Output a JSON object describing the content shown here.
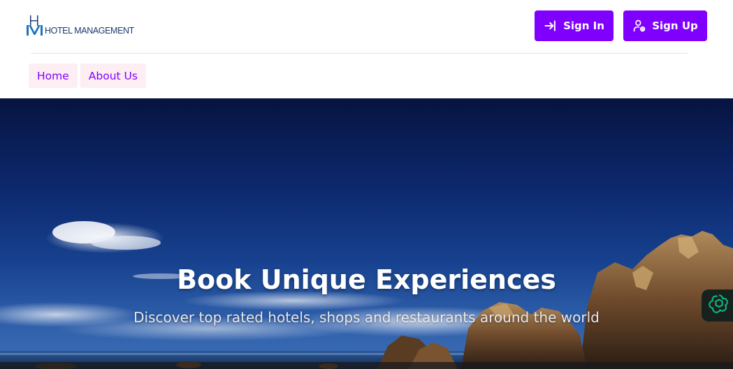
{
  "logo": {
    "mark_top": "H",
    "mark_bottom": "M",
    "text": "HOTEL MANAGEMENT"
  },
  "auth": {
    "signin_label": "Sign In",
    "signin_icon": "login-arrow-icon",
    "signup_label": "Sign Up",
    "signup_icon": "user-add-icon"
  },
  "nav": {
    "items": [
      {
        "label": "Home"
      },
      {
        "label": "About Us"
      }
    ]
  },
  "hero": {
    "title": "Book Unique Experiences",
    "subtitle": "Discover top rated hotels, shops and restaurants around the world"
  },
  "assistant": {
    "icon": "ai-assistant-icon"
  },
  "colors": {
    "accent": "#8000ff",
    "nav_bg": "#fdeef3",
    "logo_text": "#1b3a6b",
    "hero_sky": "#0d2a70",
    "assistant_bg": "#17221f",
    "assistant_icon": "#10b981"
  }
}
